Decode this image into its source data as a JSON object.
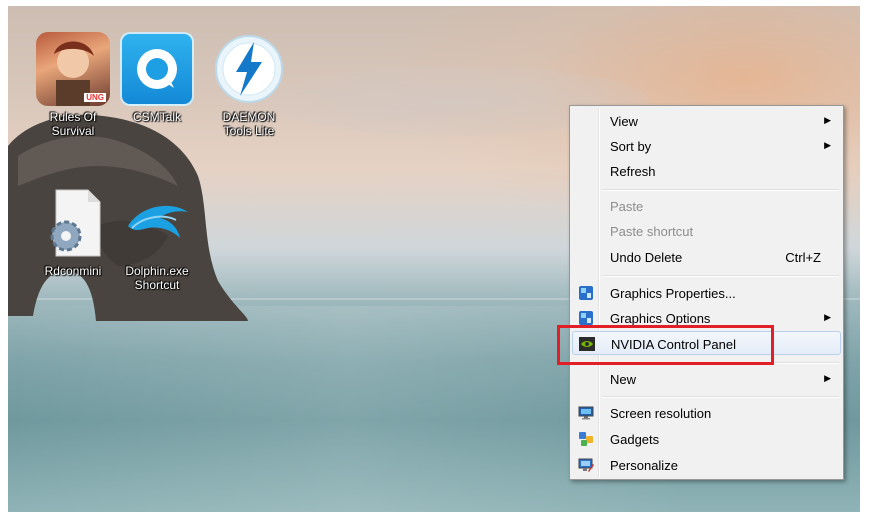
{
  "desktop": {
    "icons": [
      {
        "label": "Rules Of\nSurvival",
        "badge": "UNG",
        "icon": "game-icon"
      },
      {
        "label": "CSMTalk",
        "icon": "chat-icon"
      },
      {
        "label": "DAEMON\nTools Lite",
        "icon": "lightning-icon"
      },
      {
        "label": "Rdconmini",
        "icon": "gear-file-icon"
      },
      {
        "label": "Dolphin.exe\nShortcut",
        "icon": "dolphin-icon"
      }
    ]
  },
  "context_menu": {
    "items": [
      {
        "label": "View",
        "submenu": true
      },
      {
        "label": "Sort by",
        "submenu": true
      },
      {
        "label": "Refresh"
      },
      {
        "label": "Paste",
        "disabled": true
      },
      {
        "label": "Paste shortcut",
        "disabled": true
      },
      {
        "label": "Undo Delete",
        "shortcut": "Ctrl+Z"
      },
      {
        "label": "Graphics Properties...",
        "icon": "intel-graphics-icon"
      },
      {
        "label": "Graphics Options",
        "icon": "intel-graphics-icon",
        "submenu": true
      },
      {
        "label": "NVIDIA Control Panel",
        "icon": "nvidia-icon",
        "highlighted": true
      },
      {
        "label": "New",
        "submenu": true
      },
      {
        "label": "Screen resolution",
        "icon": "monitor-icon"
      },
      {
        "label": "Gadgets",
        "icon": "gadgets-icon"
      },
      {
        "label": "Personalize",
        "icon": "personalize-icon"
      }
    ],
    "submenu_arrow": "▶"
  },
  "annotation": {
    "color": "#e21f26"
  }
}
